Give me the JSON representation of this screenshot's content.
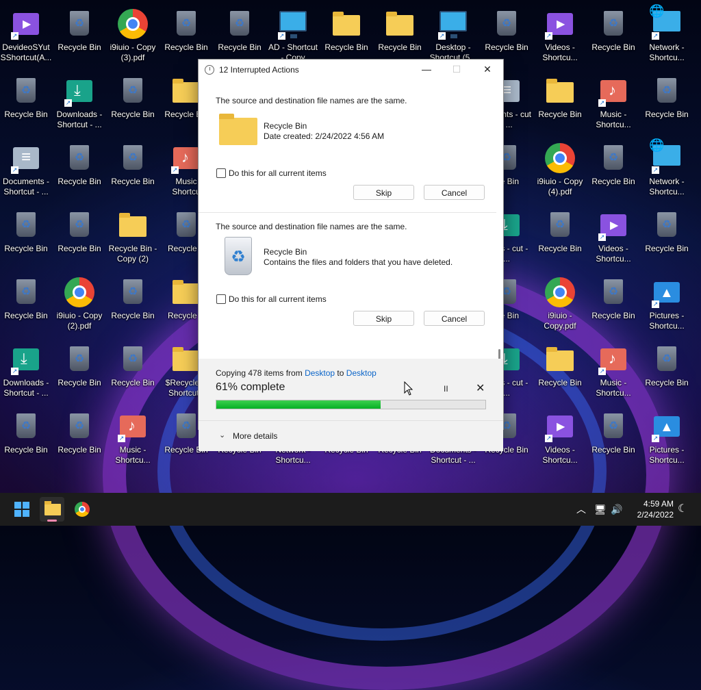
{
  "desktop": {
    "icons": [
      {
        "label": "DevideoSYut  SShortcut(A..."
      },
      {
        "label": "Recycle Bin"
      },
      {
        "label": "i9iuio - Copy (3).pdf"
      },
      {
        "label": "Recycle Bin"
      },
      {
        "label": "Recycle Bin"
      },
      {
        "label": "AD - Shortcut - Copy"
      },
      {
        "label": "Recycle Bin"
      },
      {
        "label": "Recycle Bin"
      },
      {
        "label": "Desktop - Shortcut (5..."
      },
      {
        "label": "Recycle Bin"
      },
      {
        "label": "Videos - Shortcu..."
      },
      {
        "label": "Recycle Bin"
      },
      {
        "label": "Network - Shortcu..."
      },
      {
        "label": "Recycle Bin"
      },
      {
        "label": "Downloads - Shortcut - ..."
      },
      {
        "label": "Recycle Bin"
      },
      {
        "label": "Recycle Bin"
      },
      {
        "label": "cuments - cut - ..."
      },
      {
        "label": "Recycle Bin"
      },
      {
        "label": "Music - Shortcu..."
      },
      {
        "label": "Recycle Bin"
      },
      {
        "label": "Documents - Shortcut - ..."
      },
      {
        "label": "Recycle Bin"
      },
      {
        "label": "Recycle Bin"
      },
      {
        "label": "Music Shortcu"
      },
      {
        "label": "cle Bin"
      },
      {
        "label": "i9iuio - Copy (4).pdf"
      },
      {
        "label": "Recycle Bin"
      },
      {
        "label": "Network - Shortcu..."
      },
      {
        "label": "Recycle Bin"
      },
      {
        "label": "Recycle Bin"
      },
      {
        "label": "Recycle Bin - Copy (2)"
      },
      {
        "label": "Recycle B"
      },
      {
        "label": "loads - cut - ..."
      },
      {
        "label": "Recycle Bin"
      },
      {
        "label": "Videos - Shortcu..."
      },
      {
        "label": "Recycle Bin"
      },
      {
        "label": "Recycle Bin"
      },
      {
        "label": "i9iuio - Copy (2).pdf"
      },
      {
        "label": "Recycle Bin"
      },
      {
        "label": "Recycle B"
      },
      {
        "label": "cle Bin"
      },
      {
        "label": "i9iuio - Copy.pdf"
      },
      {
        "label": "Recycle Bin"
      },
      {
        "label": "Pictures - Shortcu..."
      },
      {
        "label": "Downloads - Shortcut - ..."
      },
      {
        "label": "Recycle Bin"
      },
      {
        "label": "Recycle Bin"
      },
      {
        "label": "$Recycle.B Shortcut -"
      },
      {
        "label": "loads - cut - ..."
      },
      {
        "label": "Recycle Bin"
      },
      {
        "label": "Music - Shortcu..."
      },
      {
        "label": "Recycle Bin"
      },
      {
        "label": "Recycle Bin"
      },
      {
        "label": "Recycle Bin"
      },
      {
        "label": "Music - Shortcu..."
      },
      {
        "label": "Recycle Bin"
      },
      {
        "label": "Recycle Bin"
      },
      {
        "label": "Network - Shortcu..."
      },
      {
        "label": "Recycle Bin"
      },
      {
        "label": "Recycle Bin"
      },
      {
        "label": "Documents - Shortcut - ..."
      },
      {
        "label": "Recycle Bin"
      },
      {
        "label": "Videos - Shortcu..."
      },
      {
        "label": "Recycle Bin"
      },
      {
        "label": "Pictures - Shortcu..."
      }
    ]
  },
  "dialog": {
    "title": "12 Interrupted Actions",
    "controls": {
      "minimize": "—",
      "maximize": "☐",
      "close": "✕"
    },
    "conflicts": [
      {
        "message": "The source and destination file names are the same.",
        "item_name": "Recycle Bin",
        "item_detail": "Date created: 2/24/2022 4:56 AM",
        "icon": "folder-icon",
        "checkbox_label": "Do this for all current items",
        "checked": false,
        "skip_label": "Skip",
        "cancel_label": "Cancel"
      },
      {
        "message": "The source and destination file names are the same.",
        "item_name": "Recycle Bin",
        "item_detail": "Contains the files and folders that you have deleted.",
        "icon": "recycle-bin-icon",
        "checkbox_label": "Do this for all current items",
        "checked": false,
        "skip_label": "Skip",
        "cancel_label": "Cancel"
      }
    ],
    "progress": {
      "prefix": "Copying 478 items from ",
      "source": "Desktop",
      "middle": " to ",
      "destination": "Desktop",
      "percent_text": "61% complete",
      "percent": 61,
      "pause_glyph": "II",
      "stop_glyph": "✕"
    },
    "more_details": {
      "chevron": "⌄",
      "label": "More details"
    }
  },
  "taskbar": {
    "time": "4:59 AM",
    "date": "2/24/2022",
    "tray": {
      "chevron": "︿",
      "network": "🖥",
      "volume": "🔊",
      "moon": "☾"
    }
  },
  "colors": {
    "progress_fill": "#06b025",
    "link": "#0a64c8",
    "taskbar_bg": "#1c1c1c"
  }
}
